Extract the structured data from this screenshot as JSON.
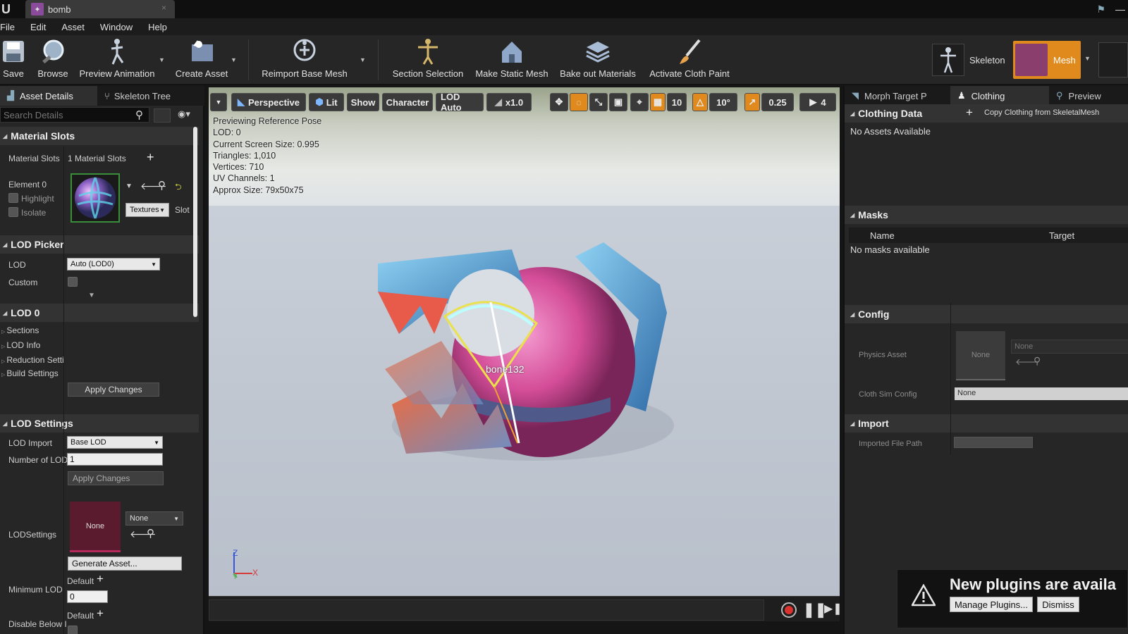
{
  "window": {
    "tab_title": "bomb"
  },
  "menu": [
    "File",
    "Edit",
    "Asset",
    "Window",
    "Help"
  ],
  "toolbar": {
    "save": "Save",
    "browse": "Browse",
    "preview_animation": "Preview Animation",
    "create_asset": "Create Asset",
    "reimport": "Reimport Base Mesh",
    "section_selection": "Section Selection",
    "make_static_mesh": "Make Static Mesh",
    "bake_materials": "Bake out Materials",
    "cloth_paint": "Activate Cloth Paint",
    "mode_skeleton": "Skeleton",
    "mode_mesh": "Mesh"
  },
  "left_panel": {
    "tabs": [
      "Asset Details",
      "Skeleton Tree"
    ],
    "search_placeholder": "Search Details",
    "material_slots": {
      "header": "Material Slots",
      "label": "Material Slots",
      "count": "1 Material Slots",
      "element": "Element 0",
      "highlight": "Highlight",
      "isolate": "Isolate",
      "textures": "Textures",
      "slot": "Slot"
    },
    "lod_picker": {
      "header": "LOD Picker",
      "lod_label": "LOD",
      "lod_value": "Auto (LOD0)",
      "custom_label": "Custom"
    },
    "lod0": {
      "header": "LOD 0",
      "items": [
        "Sections",
        "LOD Info",
        "Reduction Setti",
        "Build Settings"
      ],
      "apply": "Apply Changes"
    },
    "lod_settings": {
      "header": "LOD Settings",
      "import_label": "LOD Import",
      "import_value": "Base LOD",
      "number_label": "Number of LOD",
      "number_value": "1",
      "apply": "Apply Changes",
      "settings_label": "LODSettings",
      "asset_none": "None",
      "asset_dropdown": "None",
      "generate": "Generate Asset...",
      "min_lod_label": "Minimum LOD",
      "min_default": "Default",
      "min_value": "0",
      "disable_label": "Disable Below I",
      "disable_default": "Default"
    }
  },
  "viewport": {
    "buttons": {
      "perspective": "Perspective",
      "lit": "Lit",
      "show": "Show",
      "character": "Character",
      "lod": "LOD Auto",
      "speed": "x1.0",
      "grid": "10",
      "angle": "10°",
      "scale": "0.25",
      "cam": "4"
    },
    "stats": [
      "Previewing Reference Pose",
      "LOD: 0",
      "Current Screen Size: 0.995",
      "Triangles: 1,010",
      "Vertices: 710",
      "UV Channels: 1",
      "Approx Size: 79x50x75"
    ],
    "bone_label": "bone132",
    "axis": {
      "z": "Z",
      "x": "X",
      "y": "Y"
    }
  },
  "right_panel": {
    "tabs": [
      "Morph Target P",
      "Clothing",
      "Preview"
    ],
    "clothing_data": {
      "header": "Clothing Data",
      "copy_btn": "Copy Clothing from SkeletalMesh",
      "empty": "No Assets Available"
    },
    "masks": {
      "header": "Masks",
      "col_name": "Name",
      "col_target": "Target",
      "empty": "No masks available"
    },
    "config": {
      "header": "Config",
      "physics_label": "Physics Asset",
      "physics_thumb": "None",
      "physics_value": "None",
      "cloth_label": "Cloth Sim Config",
      "cloth_value": "None"
    },
    "import": {
      "header": "Import",
      "path_label": "Imported File Path"
    }
  },
  "notification": {
    "title": "New plugins are availa",
    "manage": "Manage Plugins...",
    "dismiss": "Dismiss"
  }
}
